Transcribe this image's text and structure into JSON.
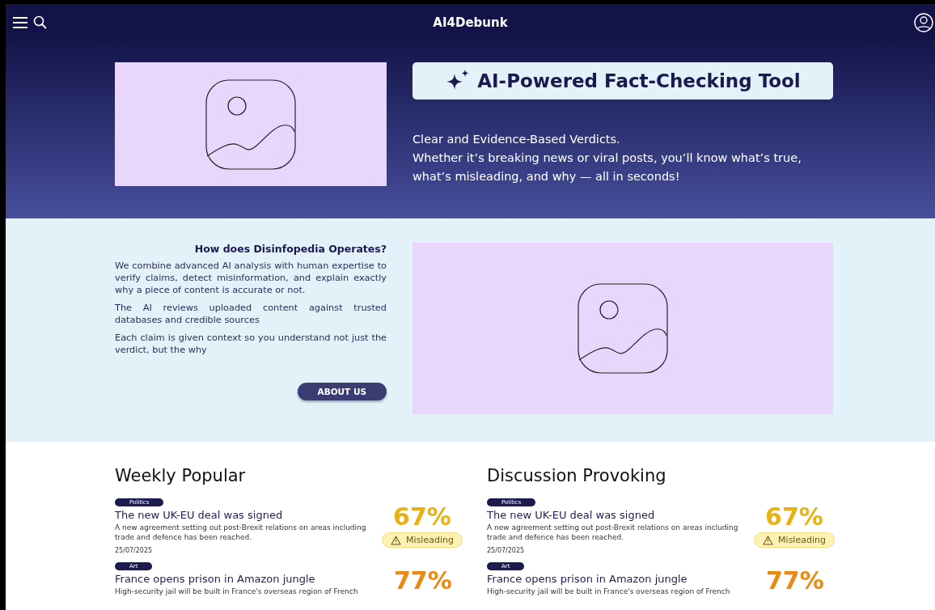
{
  "header": {
    "logo": "AI4Debunk"
  },
  "hero": {
    "title": "AI-Powered Fact-Checking Tool",
    "lines": [
      "Clear and Evidence-Based Verdicts.",
      "Whether it’s breaking news or viral posts, you’ll know what’s true, what’s misleading, and why — all in seconds!"
    ]
  },
  "about": {
    "heading": "How does Disinfopedia Operates?",
    "paragraphs": [
      "We combine advanced AI analysis with human expertise to verify claims, detect misinformation, and explain exactly why a piece of content is accurate or not.",
      "The AI reviews uploaded content against trusted databases and credible sources",
      "Each claim is given context so you understand not just the verdict, but the why"
    ],
    "button": "ABOUT US"
  },
  "lists": [
    {
      "title": "Weekly Popular",
      "items": [
        {
          "tag": "Politics",
          "headline": "The new UK-EU deal was signed",
          "summary": "A new agreement setting out post-Brexit relations on areas including trade and defence has been reached.",
          "date": "25/07/2025",
          "score": "67%",
          "color": "#e8b212",
          "verdict": "Misleading"
        },
        {
          "tag": "Art",
          "headline": "France opens prison in Amazon jungle",
          "summary": "High-security jail will be built in France's overseas region of French",
          "score": "77%",
          "color": "#ea8a12"
        }
      ]
    },
    {
      "title": "Discussion Provoking",
      "items": [
        {
          "tag": "Politics",
          "headline": "The new UK-EU deal was signed",
          "summary": "A new agreement setting out post-Brexit relations on areas including trade and defence has been reached.",
          "date": "25/07/2025",
          "score": "67%",
          "color": "#e8b212",
          "verdict": "Misleading"
        },
        {
          "tag": "Art",
          "headline": "France opens prison in Amazon jungle",
          "summary": "High-security jail will be built in France's overseas region of French",
          "score": "77%",
          "color": "#ea8a12"
        }
      ]
    }
  ]
}
